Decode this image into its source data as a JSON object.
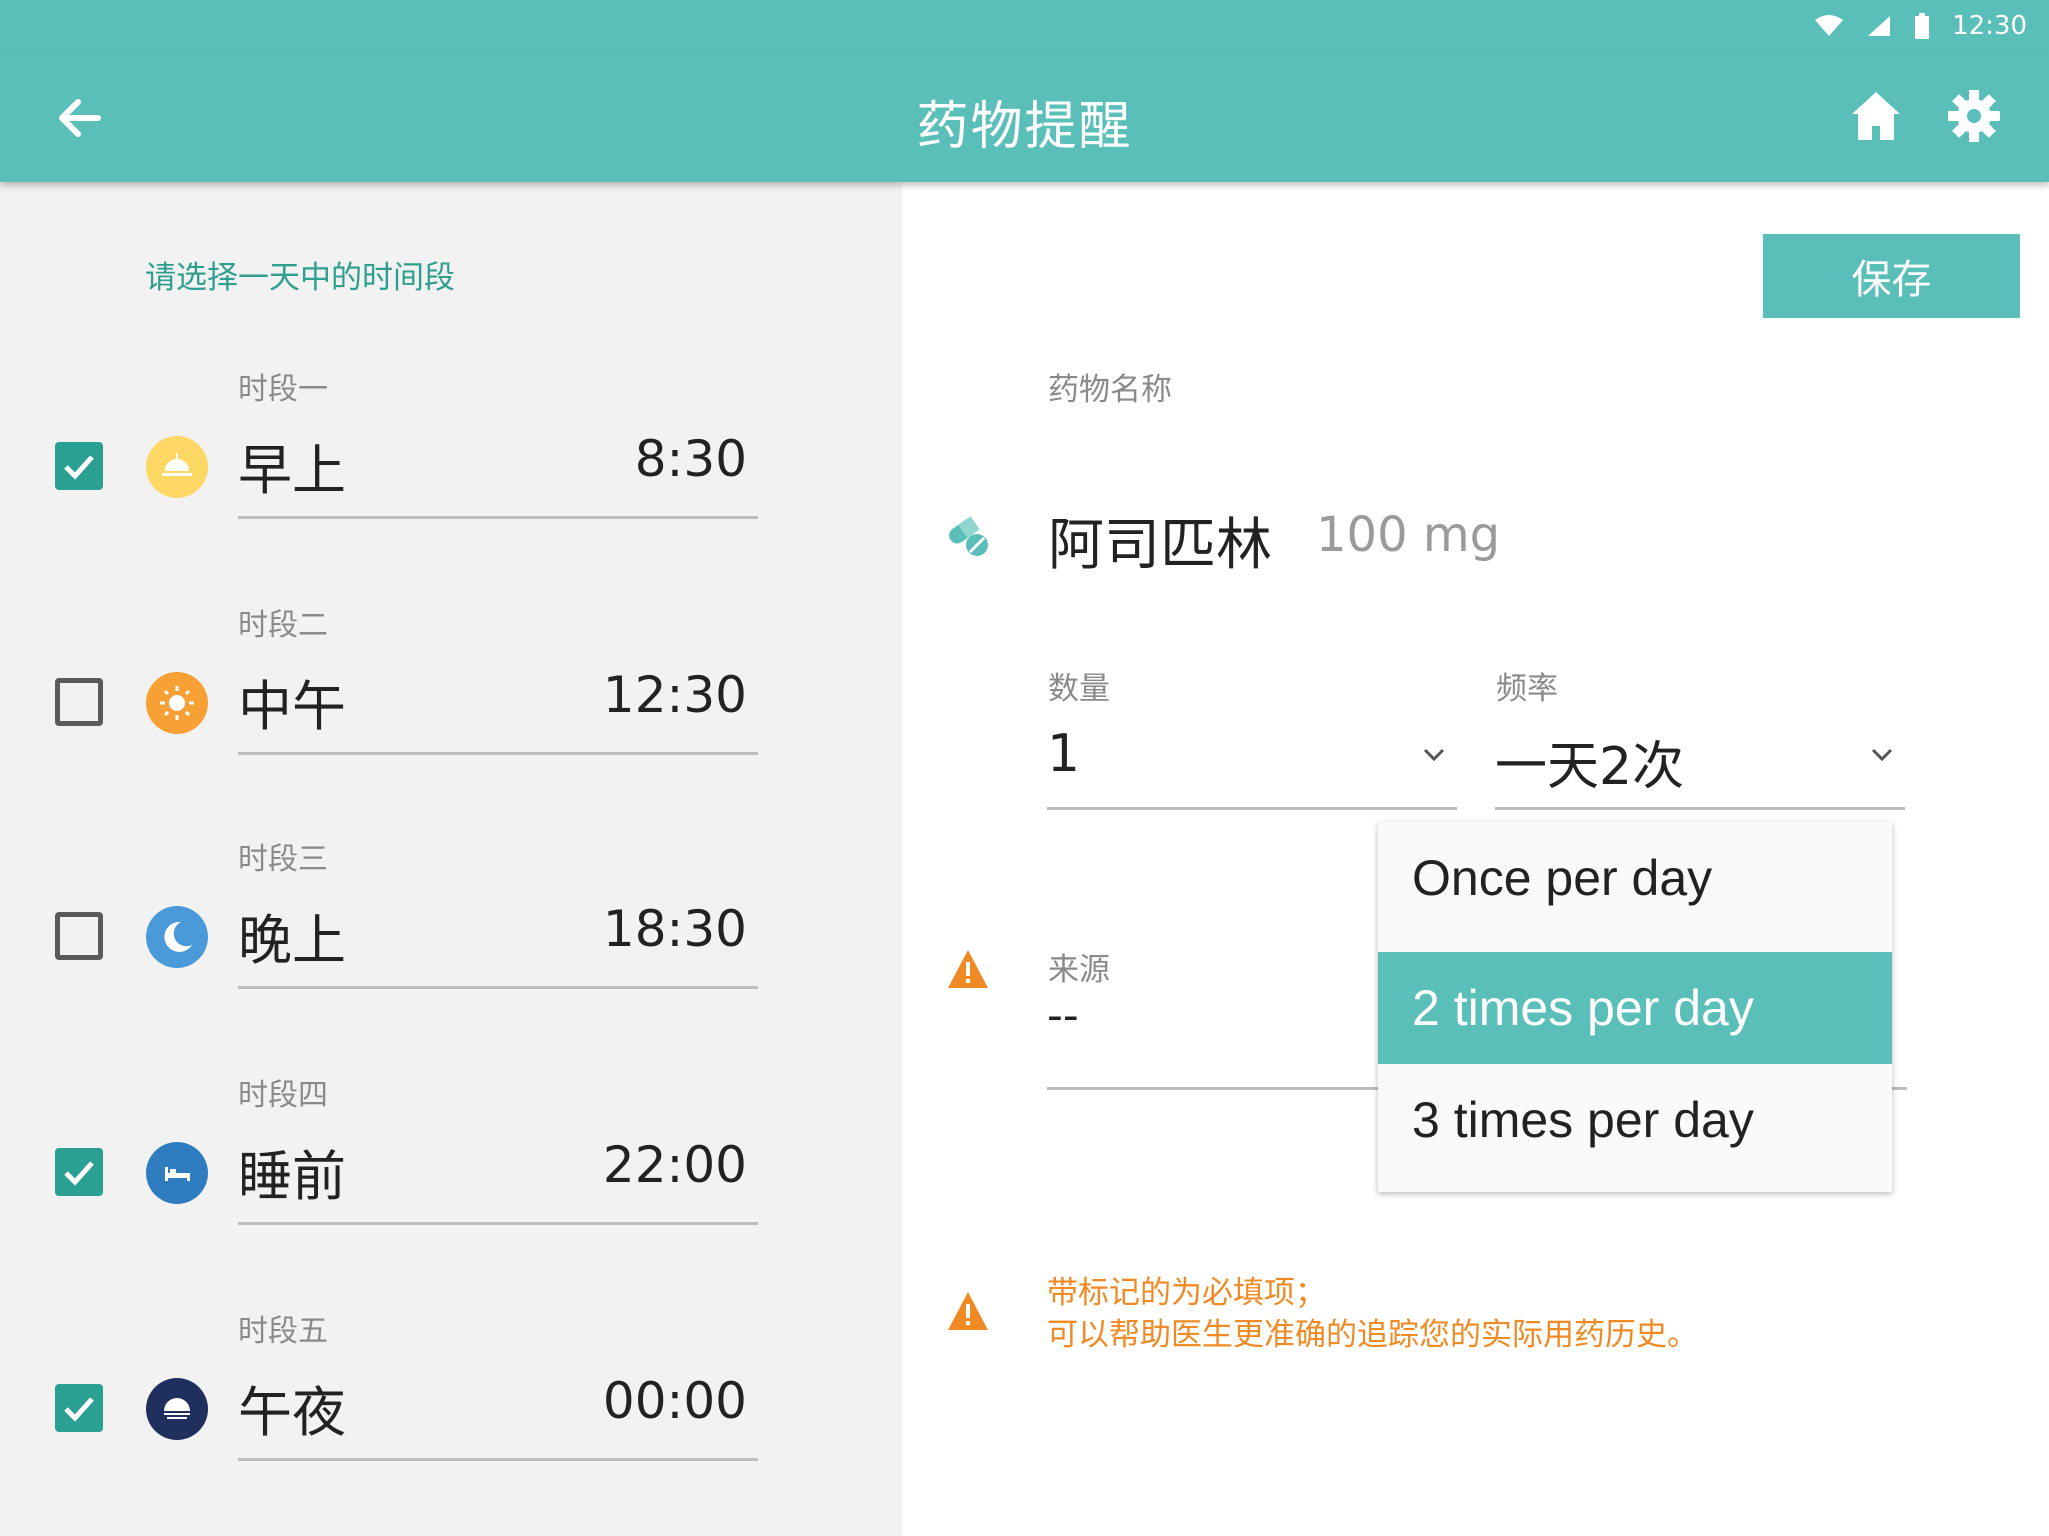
{
  "status_bar": {
    "time": "12:30"
  },
  "app_bar": {
    "title": "药物提醒",
    "back_icon": "arrow-left-icon",
    "home_icon": "home-icon",
    "settings_icon": "gear-icon"
  },
  "left_panel": {
    "heading": "请选择一天中的时间段",
    "slots": [
      {
        "label": "时段一",
        "name": "早上",
        "time": "8:30",
        "checked": true,
        "icon": "sunrise-icon",
        "icon_color": "#fdd865"
      },
      {
        "label": "时段二",
        "name": "中午",
        "time": "12:30",
        "checked": false,
        "icon": "sun-icon",
        "icon_color": "#f7a033"
      },
      {
        "label": "时段三",
        "name": "晚上",
        "time": "18:30",
        "checked": false,
        "icon": "moon-icon",
        "icon_color": "#4a9ad9"
      },
      {
        "label": "时段四",
        "name": "睡前",
        "time": "22:00",
        "checked": true,
        "icon": "bed-icon",
        "icon_color": "#2f7cc0"
      },
      {
        "label": "时段五",
        "name": "午夜",
        "time": "00:00",
        "checked": true,
        "icon": "moonrise-icon",
        "icon_color": "#1f2f5e"
      }
    ]
  },
  "form": {
    "save_label": "保存",
    "drug_label": "药物名称",
    "drug_name": "阿司匹林",
    "drug_dose": "100 mg",
    "quantity_label": "数量",
    "quantity_value": "1",
    "frequency_label": "频率",
    "frequency_value": "一天2次",
    "source_label": "来源",
    "source_value": "--",
    "frequency_options": [
      "Once per day",
      "2 times per day",
      "3 times per day"
    ],
    "selected_frequency_index": 1,
    "note_line1": "带标记的为必填项；",
    "note_line2": "可以帮助医生更准确的追踪您的实际用药历史。"
  },
  "colors": {
    "primary": "#5bbfb9",
    "check": "#2aa092",
    "warning": "#f08a24"
  }
}
